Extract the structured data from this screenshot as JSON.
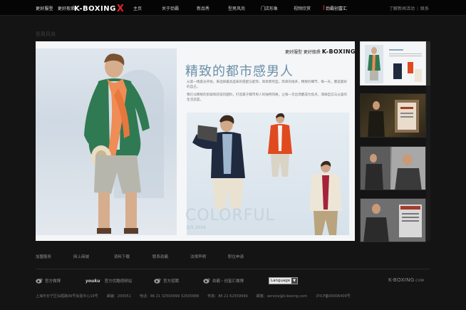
{
  "header": {
    "slogan": [
      "更好服型",
      "更好般质"
    ],
    "logo_text": "K-BOXING",
    "logo_mark": "X",
    "nav": [
      {
        "label": "主页"
      },
      {
        "label": "关于劲霸"
      },
      {
        "label": "新品秀"
      },
      {
        "label": "型男风尚"
      },
      {
        "label": "门店形象"
      },
      {
        "label": "视频欣赏"
      },
      {
        "label": "劲霸创富汇"
      }
    ],
    "top_links": [
      "了解新闻活动",
      "联系"
    ]
  },
  "section_label": "型男风尚",
  "magazine": {
    "brand_slogan": "更好服型 更好般质",
    "brand_logo": "K-BOXING",
    "title": "精致的都市感男人",
    "paragraph_1": "从第一缕晨光开始，来选择最具品味的搭配与配饰，简单而有型。简单的线条，精致的细节，每一天，都是最好的自己。",
    "paragraph_2": "我们以精致的剪裁和舒适的面料，打造属于都市男人的独特风格，让每一次出场都成为焦点，演绎自信与从容的生活态度。",
    "colorful": "COLORFUL",
    "season": "S/S 2016"
  },
  "thumbnails": [
    {
      "label": "thumb-1"
    },
    {
      "label": "thumb-2"
    },
    {
      "label": "thumb-3"
    },
    {
      "label": "thumb-4"
    }
  ],
  "footer": {
    "links": [
      "加盟服务",
      "网上商城",
      "资料下载",
      "联系劲霸",
      "法律声明",
      "职位申请"
    ],
    "social": [
      {
        "label": "官方微博"
      },
      {
        "label": "官方优酷视频站"
      },
      {
        "label": "官方招聘"
      },
      {
        "label": "劲霸・创富汇微博"
      }
    ],
    "youku": "youku",
    "language": "Language",
    "logo": "K-BOXING",
    "logo_suffix": ".COM",
    "contact": [
      "上海市长宁区仙霞路99号尚嘉中心19号",
      "邮编：200051",
      "电话：86 21 32500999 32500988",
      "传真：86 21 62559999",
      "邮箱：service@k-boxing.com",
      "沪ICP备09006409号"
    ]
  }
}
